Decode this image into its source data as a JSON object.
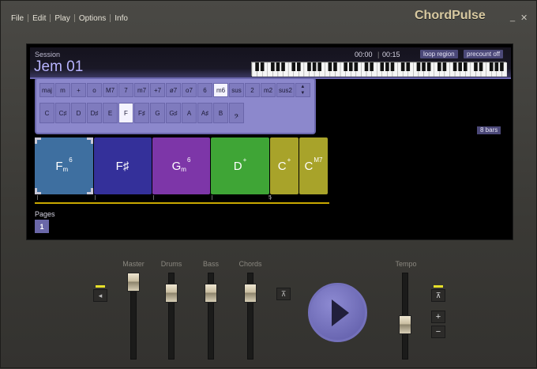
{
  "menu": [
    "File",
    "Edit",
    "Play",
    "Options",
    "Info"
  ],
  "app_title": "ChordPulse",
  "window_buttons": {
    "minimize": "_",
    "close": "✕"
  },
  "session": {
    "label": "Session",
    "name": "Jem 01",
    "time_current": "00:00",
    "time_total": "00:15",
    "loop_region": "loop region",
    "precount": "precount off"
  },
  "qualities": [
    "maj",
    "m",
    "+",
    "o",
    "M7",
    "7",
    "m7",
    "+7",
    "ø7",
    "o7",
    "6",
    "m6",
    "sus",
    "2",
    "m2",
    "sus2"
  ],
  "selected_quality": "m6",
  "notes": [
    "C",
    "C♯",
    "D",
    "D♯",
    "E",
    "F",
    "F♯",
    "G",
    "G♯",
    "A",
    "A♯",
    "B"
  ],
  "selected_note": "F",
  "clef_icon": "bass-clef-icon",
  "bars": "8 bars",
  "chords": [
    {
      "root": "F",
      "sub": "m",
      "sup": "6",
      "color": "#3e6fa0"
    },
    {
      "root": "F♯",
      "sub": "",
      "sup": "",
      "color": "#34309a"
    },
    {
      "root": "G",
      "sub": "m",
      "sup": "6",
      "color": "#7d36a8"
    },
    {
      "root": "D",
      "sub": "",
      "sup": "+",
      "color": "#3fa536"
    },
    {
      "root": "C",
      "sub": "",
      "sup": "+",
      "color": "#a8a32a"
    },
    {
      "root": "C",
      "sub": "",
      "sup": "M7",
      "color": "#a8a32a"
    }
  ],
  "timeline_marker": "5",
  "pages": {
    "label": "Pages",
    "current": "1"
  },
  "mixer": {
    "master": "Master",
    "drums": "Drums",
    "bass": "Bass",
    "chords": "Chords",
    "tempo": "Tempo",
    "tempo_plus": "+",
    "tempo_minus": "−"
  },
  "accent_colors": {
    "led": "#e6e02a",
    "purple": "#8c88cc",
    "timeline": "#c9a800"
  }
}
